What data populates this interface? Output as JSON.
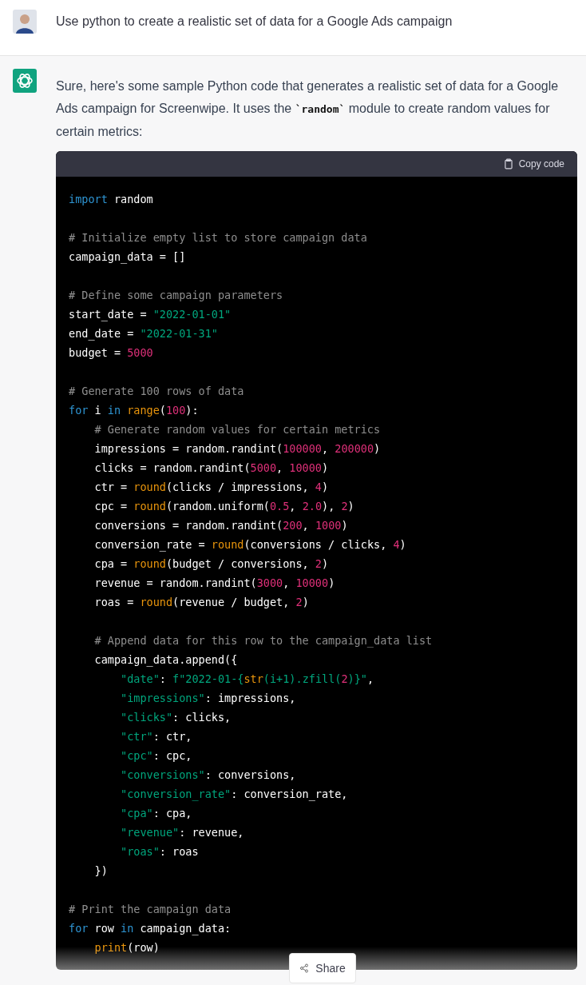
{
  "user_message": {
    "text": "Use python to create a realistic set of data for a Google Ads campaign"
  },
  "assistant_message": {
    "before": "Sure, here's some sample Python code that generates a realistic set of data for a Google Ads campaign for Screenwipe. It uses the ",
    "code": "`random`",
    "after": " module to create random values for certain metrics:"
  },
  "code_block": {
    "copy_label": "Copy code",
    "lines": [
      {
        "kind": "code",
        "tokens": [
          {
            "kind": "keyword",
            "text": "import"
          },
          {
            "kind": "plain",
            "text": " random"
          }
        ]
      },
      {
        "kind": "blank"
      },
      {
        "kind": "code",
        "tokens": [
          {
            "kind": "comment",
            "text": "# Initialize empty list to store campaign data"
          }
        ]
      },
      {
        "kind": "code",
        "tokens": [
          {
            "kind": "plain",
            "text": "campaign_data = []"
          }
        ]
      },
      {
        "kind": "blank"
      },
      {
        "kind": "code",
        "tokens": [
          {
            "kind": "comment",
            "text": "# Define some campaign parameters"
          }
        ]
      },
      {
        "kind": "code",
        "tokens": [
          {
            "kind": "plain",
            "text": "start_date = "
          },
          {
            "kind": "string",
            "text": "\"2022-01-01\""
          }
        ]
      },
      {
        "kind": "code",
        "tokens": [
          {
            "kind": "plain",
            "text": "end_date = "
          },
          {
            "kind": "string",
            "text": "\"2022-01-31\""
          }
        ]
      },
      {
        "kind": "code",
        "tokens": [
          {
            "kind": "plain",
            "text": "budget = "
          },
          {
            "kind": "number",
            "text": "5000"
          }
        ]
      },
      {
        "kind": "blank"
      },
      {
        "kind": "code",
        "tokens": [
          {
            "kind": "comment",
            "text": "# Generate 100 rows of data"
          }
        ]
      },
      {
        "kind": "code",
        "tokens": [
          {
            "kind": "keyword",
            "text": "for"
          },
          {
            "kind": "plain",
            "text": " i "
          },
          {
            "kind": "keyword",
            "text": "in"
          },
          {
            "kind": "builtin",
            "text": " range"
          },
          {
            "kind": "plain",
            "text": "("
          },
          {
            "kind": "number",
            "text": "100"
          },
          {
            "kind": "plain",
            "text": "):"
          }
        ]
      },
      {
        "kind": "code",
        "tokens": [
          {
            "kind": "comment",
            "text": "    # Generate random values for certain metrics"
          }
        ]
      },
      {
        "kind": "code",
        "tokens": [
          {
            "kind": "plain",
            "text": "    impressions = random.randint("
          },
          {
            "kind": "number",
            "text": "100000"
          },
          {
            "kind": "plain",
            "text": ", "
          },
          {
            "kind": "number",
            "text": "200000"
          },
          {
            "kind": "plain",
            "text": ")"
          }
        ]
      },
      {
        "kind": "code",
        "tokens": [
          {
            "kind": "plain",
            "text": "    clicks = random.randint("
          },
          {
            "kind": "number",
            "text": "5000"
          },
          {
            "kind": "plain",
            "text": ", "
          },
          {
            "kind": "number",
            "text": "10000"
          },
          {
            "kind": "plain",
            "text": ")"
          }
        ]
      },
      {
        "kind": "code",
        "tokens": [
          {
            "kind": "plain",
            "text": "    ctr = "
          },
          {
            "kind": "builtin",
            "text": "round"
          },
          {
            "kind": "plain",
            "text": "(clicks / impressions, "
          },
          {
            "kind": "number",
            "text": "4"
          },
          {
            "kind": "plain",
            "text": ")"
          }
        ]
      },
      {
        "kind": "code",
        "tokens": [
          {
            "kind": "plain",
            "text": "    cpc = "
          },
          {
            "kind": "builtin",
            "text": "round"
          },
          {
            "kind": "plain",
            "text": "(random.uniform("
          },
          {
            "kind": "number",
            "text": "0.5"
          },
          {
            "kind": "plain",
            "text": ", "
          },
          {
            "kind": "number",
            "text": "2.0"
          },
          {
            "kind": "plain",
            "text": "), "
          },
          {
            "kind": "number",
            "text": "2"
          },
          {
            "kind": "plain",
            "text": ")"
          }
        ]
      },
      {
        "kind": "code",
        "tokens": [
          {
            "kind": "plain",
            "text": "    conversions = random.randint("
          },
          {
            "kind": "number",
            "text": "200"
          },
          {
            "kind": "plain",
            "text": ", "
          },
          {
            "kind": "number",
            "text": "1000"
          },
          {
            "kind": "plain",
            "text": ")"
          }
        ]
      },
      {
        "kind": "code",
        "tokens": [
          {
            "kind": "plain",
            "text": "    conversion_rate = "
          },
          {
            "kind": "builtin",
            "text": "round"
          },
          {
            "kind": "plain",
            "text": "(conversions / clicks, "
          },
          {
            "kind": "number",
            "text": "4"
          },
          {
            "kind": "plain",
            "text": ")"
          }
        ]
      },
      {
        "kind": "code",
        "tokens": [
          {
            "kind": "plain",
            "text": "    cpa = "
          },
          {
            "kind": "builtin",
            "text": "round"
          },
          {
            "kind": "plain",
            "text": "(budget / conversions, "
          },
          {
            "kind": "number",
            "text": "2"
          },
          {
            "kind": "plain",
            "text": ")"
          }
        ]
      },
      {
        "kind": "code",
        "tokens": [
          {
            "kind": "plain",
            "text": "    revenue = random.randint("
          },
          {
            "kind": "number",
            "text": "3000"
          },
          {
            "kind": "plain",
            "text": ", "
          },
          {
            "kind": "number",
            "text": "10000"
          },
          {
            "kind": "plain",
            "text": ")"
          }
        ]
      },
      {
        "kind": "code",
        "tokens": [
          {
            "kind": "plain",
            "text": "    roas = "
          },
          {
            "kind": "builtin",
            "text": "round"
          },
          {
            "kind": "plain",
            "text": "(revenue / budget, "
          },
          {
            "kind": "number",
            "text": "2"
          },
          {
            "kind": "plain",
            "text": ")"
          }
        ]
      },
      {
        "kind": "blank"
      },
      {
        "kind": "code",
        "tokens": [
          {
            "kind": "comment",
            "text": "    # Append data for this row to the campaign_data list"
          }
        ]
      },
      {
        "kind": "code",
        "tokens": [
          {
            "kind": "plain",
            "text": "    campaign_data.append({"
          }
        ]
      },
      {
        "kind": "code",
        "tokens": [
          {
            "kind": "string",
            "text": "        \"date\""
          },
          {
            "kind": "plain",
            "text": ": "
          },
          {
            "kind": "string",
            "text": "f\"2022-01-{"
          },
          {
            "kind": "builtin",
            "text": "str"
          },
          {
            "kind": "string",
            "text": "(i+1).zfill("
          },
          {
            "kind": "number",
            "text": "2"
          },
          {
            "kind": "string",
            "text": ")}\""
          },
          {
            "kind": "plain",
            "text": ","
          }
        ]
      },
      {
        "kind": "code",
        "tokens": [
          {
            "kind": "string",
            "text": "        \"impressions\""
          },
          {
            "kind": "plain",
            "text": ": impressions,"
          }
        ]
      },
      {
        "kind": "code",
        "tokens": [
          {
            "kind": "string",
            "text": "        \"clicks\""
          },
          {
            "kind": "plain",
            "text": ": clicks,"
          }
        ]
      },
      {
        "kind": "code",
        "tokens": [
          {
            "kind": "string",
            "text": "        \"ctr\""
          },
          {
            "kind": "plain",
            "text": ": ctr,"
          }
        ]
      },
      {
        "kind": "code",
        "tokens": [
          {
            "kind": "string",
            "text": "        \"cpc\""
          },
          {
            "kind": "plain",
            "text": ": cpc,"
          }
        ]
      },
      {
        "kind": "code",
        "tokens": [
          {
            "kind": "string",
            "text": "        \"conversions\""
          },
          {
            "kind": "plain",
            "text": ": conversions,"
          }
        ]
      },
      {
        "kind": "code",
        "tokens": [
          {
            "kind": "string",
            "text": "        \"conversion_rate\""
          },
          {
            "kind": "plain",
            "text": ": conversion_rate,"
          }
        ]
      },
      {
        "kind": "code",
        "tokens": [
          {
            "kind": "string",
            "text": "        \"cpa\""
          },
          {
            "kind": "plain",
            "text": ": cpa,"
          }
        ]
      },
      {
        "kind": "code",
        "tokens": [
          {
            "kind": "string",
            "text": "        \"revenue\""
          },
          {
            "kind": "plain",
            "text": ": revenue,"
          }
        ]
      },
      {
        "kind": "code",
        "tokens": [
          {
            "kind": "string",
            "text": "        \"roas\""
          },
          {
            "kind": "plain",
            "text": ": roas"
          }
        ]
      },
      {
        "kind": "code",
        "tokens": [
          {
            "kind": "plain",
            "text": "    })"
          }
        ]
      },
      {
        "kind": "blank"
      },
      {
        "kind": "code",
        "tokens": [
          {
            "kind": "comment",
            "text": "# Print the campaign data"
          }
        ]
      },
      {
        "kind": "code",
        "tokens": [
          {
            "kind": "keyword",
            "text": "for"
          },
          {
            "kind": "plain",
            "text": " row "
          },
          {
            "kind": "keyword",
            "text": "in"
          },
          {
            "kind": "plain",
            "text": " campaign_data:"
          }
        ]
      },
      {
        "kind": "code",
        "tokens": [
          {
            "kind": "builtin",
            "text": "    print"
          },
          {
            "kind": "plain",
            "text": "(row)"
          }
        ]
      }
    ]
  },
  "share_button": {
    "label": "Share"
  }
}
